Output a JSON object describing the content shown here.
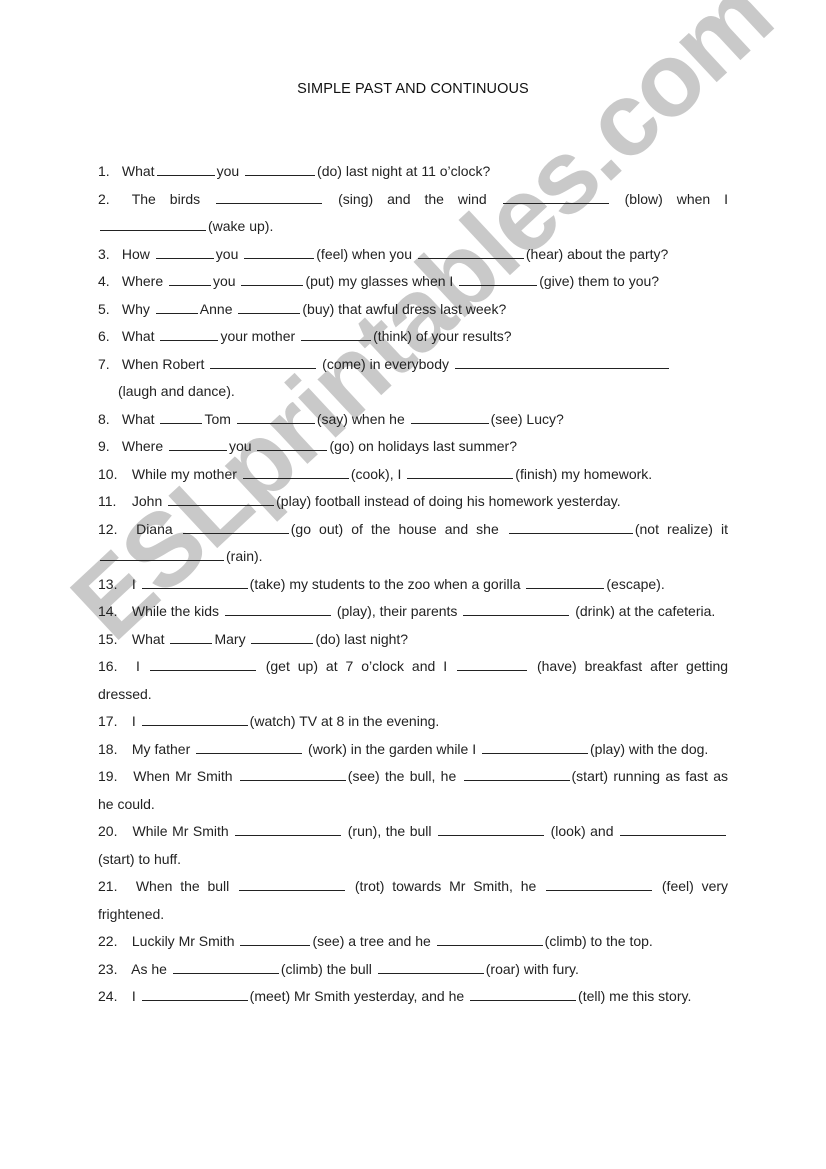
{
  "document": {
    "title": "SIMPLE PAST AND CONTINUOUS",
    "watermark": "ESLprintables.com",
    "watermark_color": "#c9c9c9",
    "questions": [
      {
        "num": "1.",
        "parts": [
          "What",
          "you",
          "(do) last night at 11 o’clock?"
        ]
      },
      {
        "num": "2.",
        "parts": [
          "The birds",
          "(sing) and the wind",
          "(blow) when I",
          "(wake up)."
        ]
      },
      {
        "num": "3.",
        "parts": [
          "How",
          "you",
          "(feel) when you",
          "(hear) about the party?"
        ]
      },
      {
        "num": "4.",
        "parts": [
          "Where",
          "you",
          "(put) my glasses when I",
          "(give) them to you?"
        ]
      },
      {
        "num": "5.",
        "parts": [
          "Why",
          "Anne",
          "(buy) that awful dress last week?"
        ]
      },
      {
        "num": "6.",
        "parts": [
          "What",
          "your mother",
          "(think) of your results?"
        ]
      },
      {
        "num": "7.",
        "parts": [
          "When Robert",
          "(come) in everybody",
          "(laugh and dance)."
        ]
      },
      {
        "num": "8.",
        "parts": [
          "What",
          "Tom",
          "(say) when he",
          "(see) Lucy?"
        ]
      },
      {
        "num": "9.",
        "parts": [
          "Where",
          "you",
          "(go) on holidays last summer?"
        ]
      },
      {
        "num": "10.",
        "parts": [
          "While my mother",
          "(cook), I",
          "(finish) my homework."
        ]
      },
      {
        "num": "11.",
        "parts": [
          "John",
          "(play) football instead of doing his homework yesterday."
        ]
      },
      {
        "num": "12.",
        "parts": [
          "Diana",
          "(go out) of the house and she",
          "(not realize) it",
          "(rain)."
        ]
      },
      {
        "num": "13.",
        "parts": [
          "I",
          "(take) my students to the zoo when a gorilla",
          "(escape)."
        ]
      },
      {
        "num": "14.",
        "parts": [
          "While the kids",
          "(play), their parents",
          "(drink) at the cafeteria."
        ]
      },
      {
        "num": "15.",
        "parts": [
          "What",
          "Mary",
          "(do) last night?"
        ]
      },
      {
        "num": "16.",
        "parts": [
          "I",
          "(get up) at 7 o’clock and I",
          "(have) breakfast after getting dressed."
        ]
      },
      {
        "num": "17.",
        "parts": [
          "I",
          "(watch) TV at 8 in the evening."
        ]
      },
      {
        "num": "18.",
        "parts": [
          "My father",
          "(work) in the garden while I",
          "(play) with the dog."
        ]
      },
      {
        "num": "19.",
        "parts": [
          "When Mr Smith",
          "(see) the bull, he",
          "(start) running as fast as he could."
        ]
      },
      {
        "num": "20.",
        "parts": [
          "While Mr Smith",
          "(run), the bull",
          "(look) and",
          "(start) to huff."
        ]
      },
      {
        "num": "21.",
        "parts": [
          "When the bull",
          "(trot) towards Mr Smith, he",
          "(feel) very frightened."
        ]
      },
      {
        "num": "22.",
        "parts": [
          "Luckily Mr Smith",
          "(see) a tree and he",
          "(climb) to the top."
        ]
      },
      {
        "num": "23.",
        "parts": [
          "As he",
          "(climb) the bull",
          "(roar) with fury."
        ]
      },
      {
        "num": "24.",
        "parts": [
          "I",
          "(meet) Mr Smith yesterday, and he",
          "(tell) me this story."
        ]
      }
    ]
  }
}
